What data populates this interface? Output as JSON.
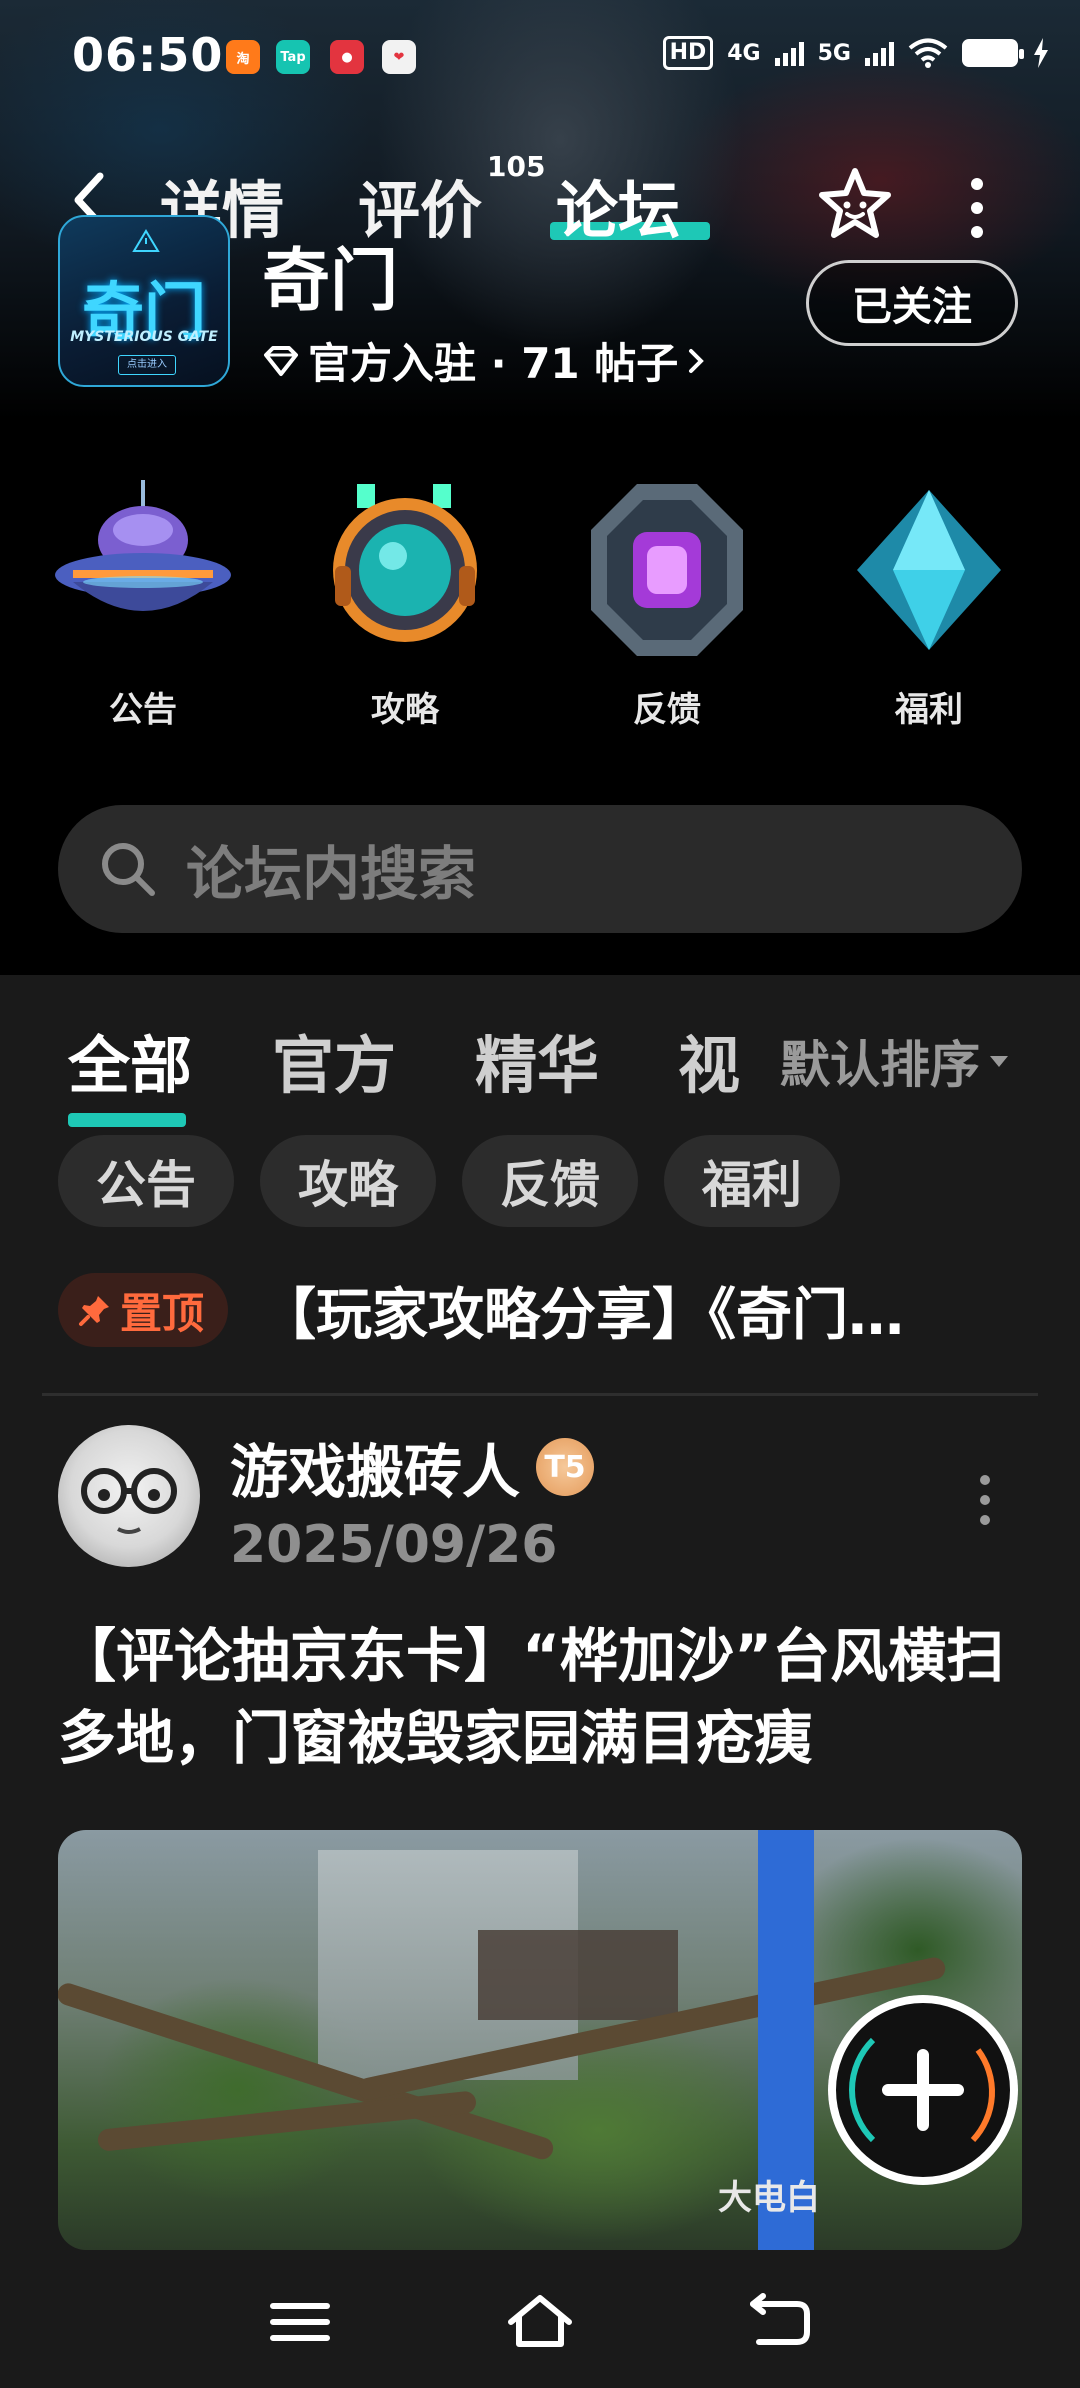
{
  "status_bar": {
    "time": "06:50",
    "hd_label": "HD",
    "net1": "4G",
    "net2": "5G",
    "notifications": [
      "taobao-icon",
      "taptap-icon",
      "app-icon-1",
      "app-icon-2"
    ]
  },
  "nav": {
    "tabs": [
      {
        "label": "详情"
      },
      {
        "label": "评价",
        "badge": "105"
      },
      {
        "label": "论坛"
      }
    ]
  },
  "game": {
    "name": "奇门",
    "logo_text": "奇门",
    "logo_sub": "MYSTERIOUS GATE",
    "logo_btn": "点击进入",
    "meta": "官方入驻 · 71 帖子",
    "follow_label": "已关注"
  },
  "categories": [
    {
      "label": "公告"
    },
    {
      "label": "攻略"
    },
    {
      "label": "反馈"
    },
    {
      "label": "福利"
    }
  ],
  "search": {
    "placeholder": "论坛内搜索"
  },
  "filters": {
    "tabs": [
      {
        "label": "全部"
      },
      {
        "label": "官方"
      },
      {
        "label": "精华"
      },
      {
        "label": "视"
      }
    ],
    "sort_label": "默认排序",
    "chips": [
      "公告",
      "攻略",
      "反馈",
      "福利"
    ]
  },
  "pinned": {
    "tag": "置顶",
    "title": "【玩家攻略分享】《奇门…"
  },
  "post": {
    "author": "游戏搬砖人",
    "level": "T5",
    "date": "2025/09/26",
    "title": "【评论抽京东卡】“桦加沙”台风横扫多地，门窗被毁家园满目疮痍",
    "image_caption": "大电白"
  },
  "colors": {
    "accent": "#1ec8b6",
    "pin": "#ff6a3d",
    "background": "#1a1a1a"
  }
}
